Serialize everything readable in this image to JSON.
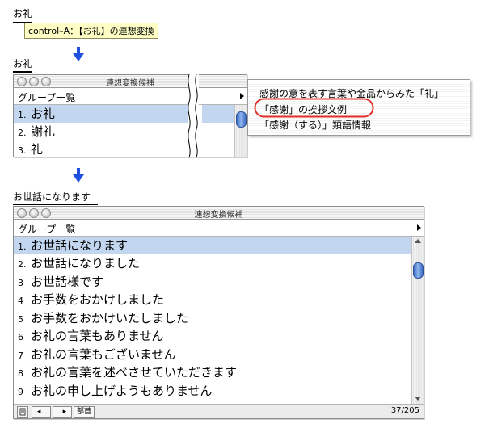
{
  "top": {
    "typed_word": "お礼",
    "tooltip": "control–A：【お礼】の連想変換",
    "label_word": "お礼"
  },
  "window1": {
    "title": "連想変換候補",
    "group_label": "グループ一覧",
    "rows": [
      {
        "num": "1.",
        "text": "お礼"
      },
      {
        "num": "2.",
        "text": "謝礼"
      },
      {
        "num": "3.",
        "text": "礼"
      }
    ]
  },
  "submenu": {
    "items": [
      "感謝の意を表す言葉や金品からみた「礼」",
      "「感謝」の挨拶文例",
      "「感謝（する）」類語情報"
    ]
  },
  "window2_label": "お世話になります",
  "window2": {
    "title": "連想変換候補",
    "group_label": "グループ一覧",
    "rows": [
      {
        "num": "1.",
        "text": "お世話になります"
      },
      {
        "num": "2.",
        "text": "お世話になりました"
      },
      {
        "num": "3",
        "text": "お世話様です"
      },
      {
        "num": "4",
        "text": "お手数をおかけしました"
      },
      {
        "num": "5",
        "text": "お手数をおかけいたしました"
      },
      {
        "num": "6",
        "text": "お礼の言葉もありません"
      },
      {
        "num": "7",
        "text": "お礼の言葉もございません"
      },
      {
        "num": "8",
        "text": "お礼の言葉を述べさせていただきます"
      },
      {
        "num": "9",
        "text": "お礼の申し上げようもありません"
      }
    ],
    "status": {
      "btn_prev": "◂..",
      "btn_next": "..▸",
      "btn_bushu": "部首",
      "count": "37/205"
    }
  },
  "colors": {
    "selection": "#c3d6f0",
    "tooltip_bg": "#ffffc6",
    "arrow_blue": "#1f4fe0",
    "highlight_ring": "#e0302a"
  }
}
